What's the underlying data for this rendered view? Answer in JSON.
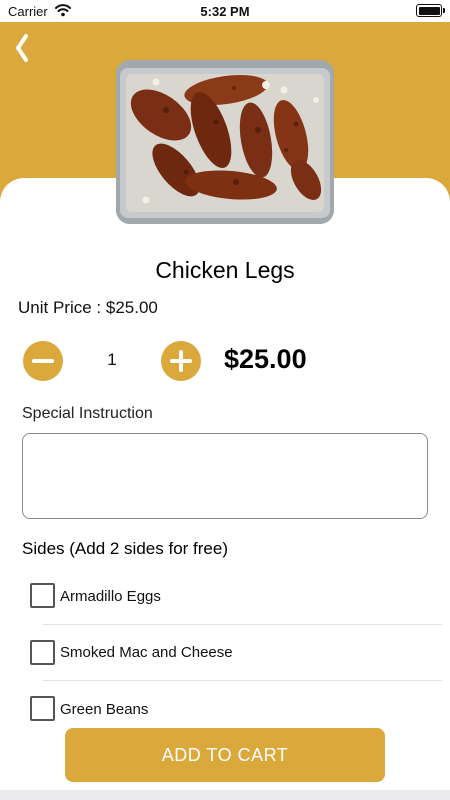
{
  "status_bar": {
    "carrier": "Carrier",
    "time": "5:32 PM"
  },
  "colors": {
    "accent": "#dba83b",
    "card": "#ffffff",
    "divider": "#e3e3e3"
  },
  "header": {
    "back_icon": "chevron-left-icon"
  },
  "product": {
    "image_alt": "Chicken Legs",
    "name": "Chicken Legs",
    "unit_price_label": "Unit Price :",
    "unit_price": "$25.00",
    "quantity": "1",
    "total": "$25.00"
  },
  "instructions": {
    "label": "Special Instruction",
    "value": "",
    "placeholder": ""
  },
  "sides": {
    "title": "Sides (Add 2 sides for free)",
    "items": [
      {
        "label": "Armadillo Eggs",
        "checked": false
      },
      {
        "label": "Smoked Mac and Cheese",
        "checked": false
      },
      {
        "label": "Green Beans",
        "checked": false
      }
    ]
  },
  "cta": {
    "label": "ADD TO CART"
  }
}
